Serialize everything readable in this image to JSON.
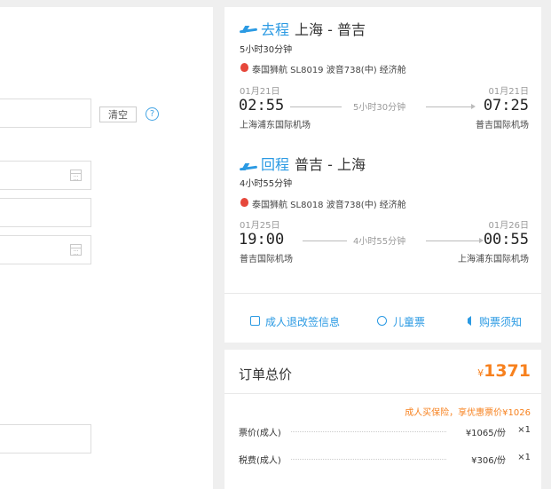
{
  "outbound": {
    "direction": "去程",
    "route": "上海 - 普吉",
    "duration": "5小时30分钟",
    "airline": "泰国狮航 SL8019 波音738(中) 经济舱",
    "dep_date": "01月21日",
    "arr_date": "01月21日",
    "dep_time": "02:55",
    "arr_time": "07:25",
    "mid_duration": "5小时30分钟",
    "dep_airport": "上海浦东国际机场",
    "arr_airport": "普吉国际机场"
  },
  "inbound": {
    "direction": "回程",
    "route": "普吉 - 上海",
    "duration": "4小时55分钟",
    "airline": "泰国狮航 SL8018 波音738(中) 经济舱",
    "dep_date": "01月25日",
    "arr_date": "01月26日",
    "dep_time": "19:00",
    "arr_time": "00:55",
    "mid_duration": "4小时55分钟",
    "dep_airport": "普吉国际机场",
    "arr_airport": "上海浦东国际机场"
  },
  "links": {
    "refund": "成人退改签信息",
    "child": "儿童票",
    "notice": "购票须知"
  },
  "form": {
    "clear_label": "清空",
    "help_symbol": "?"
  },
  "order": {
    "total_label": "订单总价",
    "currency": "¥",
    "total": "1371",
    "promo": "成人买保险，享优惠票价¥1026",
    "fees": [
      {
        "label": "票价(成人)",
        "value": "¥1065/份",
        "qty": "×1"
      },
      {
        "label": "税费(成人)",
        "value": "¥306/份",
        "qty": "×1"
      }
    ]
  },
  "colors": {
    "accent": "#2b9ae3",
    "price": "#f7811e",
    "airline_logo": "#e6473b"
  }
}
